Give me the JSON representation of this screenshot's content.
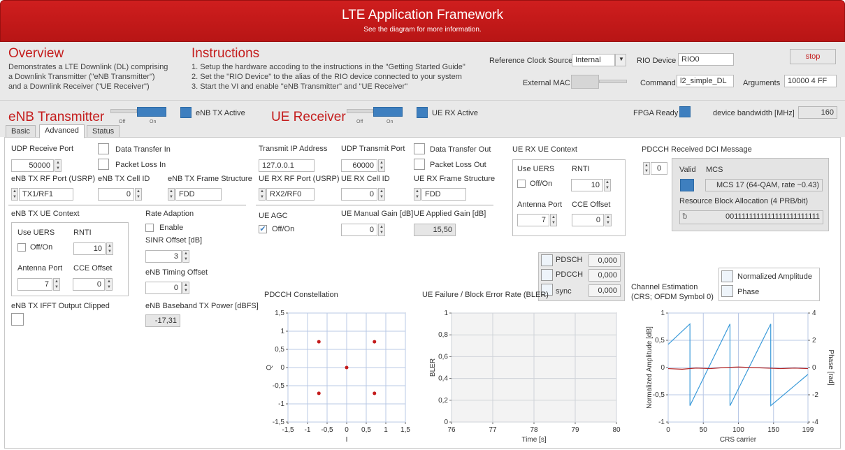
{
  "header": {
    "title": "LTE Application Framework",
    "subtitle": "See the diagram for more information."
  },
  "overview": {
    "title": "Overview",
    "lines": [
      "Demonstrates a LTE Downlink (DL) comprising",
      "a Downlink Transmitter (\"eNB Transmitter\")",
      "and a Downlink Receiver (\"UE Receiver\")"
    ]
  },
  "instructions": {
    "title": "Instructions",
    "lines": [
      "1. Setup the hardware accoding to the instructions in the \"Getting Started Guide\"",
      "2. Set the \"RIO Device\" to the alias of the RIO device connected to your system",
      "3. Start the VI and enable \"eNB Transmitter\" and \"UE Receiver\""
    ]
  },
  "config": {
    "ref_clock_label": "Reference Clock Source",
    "ref_clock_value": "Internal",
    "rio_label": "RIO Device",
    "rio_value": "RIO0",
    "stop_label": "stop",
    "external_mac_label": "External MAC",
    "command_label": "Command",
    "command_value": "l2_simple_DL",
    "arguments_label": "Arguments",
    "arguments_value": "10000 4 FF"
  },
  "enb": {
    "title": "eNB Transmitter",
    "off": "Off",
    "on": "On",
    "active_label": "eNB TX Active"
  },
  "ue": {
    "title": "UE Receiver",
    "off": "Off",
    "on": "On",
    "active_label": "UE RX Active"
  },
  "fpga": {
    "ready_label": "FPGA Ready",
    "bw_label": "device bandwidth [MHz]",
    "bw_value": "160"
  },
  "tabs": [
    "Basic",
    "Advanced",
    "Status"
  ],
  "adv": {
    "udp_rx_port_label": "UDP Receive Port",
    "udp_rx_port": "50000",
    "data_in_label": "Data Transfer In",
    "pkt_loss_in_label": "Packet Loss In",
    "tx_ip_label": "Transmit IP Address",
    "tx_ip": "127.0.0.1",
    "udp_tx_port_label": "UDP Transmit Port",
    "udp_tx_port": "60000",
    "data_out_label": "Data Transfer Out",
    "pkt_loss_out_label": "Packet Loss Out",
    "enb_rf_label": "eNB TX RF Port (USRP)",
    "enb_rf": "TX1/RF1",
    "enb_cell_label": "eNB TX Cell ID",
    "enb_cell": "0",
    "enb_frame_label": "eNB TX Frame Structure",
    "enb_frame": "FDD",
    "ue_rf_label": "UE RX RF Port (USRP)",
    "ue_rf": "RX2/RF0",
    "ue_cell_label": "UE RX Cell ID",
    "ue_cell": "0",
    "ue_frame_label": "UE RX Frame Structure",
    "ue_frame": "FDD",
    "enb_ue_ctx_label": "eNB TX UE Context",
    "use_uers": "Use UERS",
    "rnti": "RNTI",
    "offon": "Off/On",
    "rnti_val": "10",
    "ant_port": "Antenna Port",
    "cce": "CCE Offset",
    "ant_val": "7",
    "cce_val": "0",
    "rate_label": "Rate Adaption",
    "enable": "Enable",
    "sinr_label": "SINR Offset [dB]",
    "sinr": "3",
    "timing_label": "eNB Timing Offset",
    "timing": "0",
    "ifft_label": "eNB TX IFFT Output Clipped",
    "bb_label": "eNB Baseband TX Power [dBFS]",
    "bb": "-17,31",
    "ue_agc_label": "UE AGC",
    "agc_offon": "Off/On",
    "manual_gain_label": "UE Manual Gain [dB]",
    "manual_gain": "0",
    "applied_gain_label": "UE Applied Gain [dB]",
    "applied_gain": "15,50",
    "ue_rx_ctx_label": "UE RX UE Context",
    "ue_rnti_val": "10",
    "ue_ant_val": "7",
    "ue_cce_val": "0",
    "pdcch_dci_label": "PDCCH Received DCI Message",
    "dci_index": "0",
    "valid": "Valid",
    "mcs": "MCS",
    "mcs_value": "MCS 17 (64-QAM, rate ~0.43)",
    "rba_label": "Resource Block Allocation (4 PRB/bit)",
    "rba_value": "0011111111111111111111111"
  },
  "bler_legend": [
    {
      "name": "PDSCH",
      "value": "0,000"
    },
    {
      "name": "PDCCH",
      "value": "0,000"
    },
    {
      "name": "sync",
      "value": "0,000"
    }
  ],
  "ce_legend": [
    "Normalized Amplitude",
    "Phase"
  ],
  "chart_data": [
    {
      "type": "scatter",
      "title": "PDCCH Constellation",
      "xlabel": "I",
      "ylabel": "Q",
      "xlim": [
        -1.5,
        1.5
      ],
      "ylim": [
        -1.5,
        1.5
      ],
      "xticks": [
        "-1,5",
        "-1",
        "-0,5",
        "0",
        "0,5",
        "1",
        "1,5"
      ],
      "yticks": [
        "1,5",
        "1",
        "0,5",
        "0",
        "-0,5",
        "-1",
        "-1,5"
      ],
      "points": [
        [
          -0.71,
          0.71
        ],
        [
          0.71,
          0.71
        ],
        [
          0,
          0
        ],
        [
          -0.71,
          -0.71
        ],
        [
          0.71,
          -0.71
        ]
      ]
    },
    {
      "type": "line",
      "title": "UE Failure / Block Error Rate (BLER)",
      "xlabel": "Time [s]",
      "ylabel": "BLER",
      "xlim": [
        76,
        80
      ],
      "ylim": [
        0,
        1
      ],
      "xticks": [
        "76",
        "77",
        "78",
        "79",
        "80"
      ],
      "yticks": [
        "1",
        "0,8",
        "0,6",
        "0,4",
        "0,2",
        "0"
      ],
      "series": []
    },
    {
      "type": "line",
      "title": "Channel Estimation",
      "subtitle": "(CRS; OFDM Symbol 0)",
      "xlabel": "CRS carrier",
      "ylabel": "Normalized Amplitude [dB]",
      "y2label": "Phase [rad]",
      "xlim": [
        0,
        199
      ],
      "ylim": [
        -1,
        1
      ],
      "y2lim": [
        -4,
        4
      ],
      "xticks": [
        "0",
        "50",
        "100",
        "150",
        "199"
      ],
      "yticks": [
        "1",
        "0,5",
        "0",
        "-0,5",
        "-1"
      ],
      "y2ticks": [
        "4",
        "2",
        "0",
        "-2",
        "-4"
      ],
      "series": [
        {
          "name": "Normalized Amplitude",
          "x": [
            0,
            20,
            40,
            60,
            80,
            100,
            120,
            140,
            160,
            180,
            199
          ],
          "y": [
            -0.02,
            -0.03,
            -0.01,
            -0.02,
            0.0,
            0.01,
            0.0,
            -0.01,
            -0.02,
            -0.01,
            -0.02
          ]
        },
        {
          "name": "Phase",
          "x": [
            0,
            31,
            31,
            88,
            88,
            146,
            146,
            199
          ],
          "y": [
            1.7,
            3.2,
            -2.8,
            3.2,
            -2.8,
            3.2,
            -2.8,
            -0.5
          ]
        }
      ]
    }
  ]
}
